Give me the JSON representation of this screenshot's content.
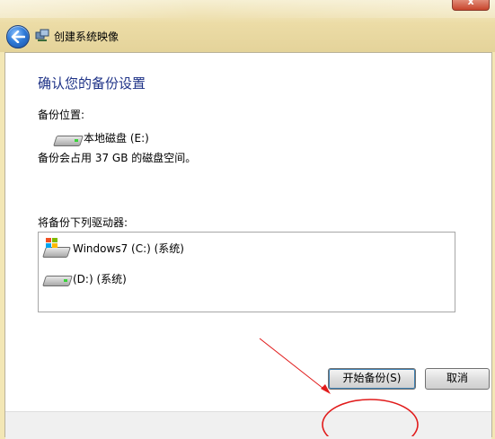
{
  "window": {
    "title": "创建系统映像",
    "close_glyph": "x"
  },
  "page": {
    "heading": "确认您的备份设置",
    "backup_location_label": "备份位置:",
    "backup_location_drive": "本地磁盘 (E:)",
    "space_note": "备份会占用 37 GB 的磁盘空间。",
    "included_drives_label": "将备份下列驱动器:",
    "included_drives": [
      {
        "label": "Windows7 (C:) (系统)",
        "icon": "windows-drive-icon"
      },
      {
        "label": "(D:) (系统)",
        "icon": "hard-drive-icon"
      }
    ]
  },
  "buttons": {
    "start_backup": "开始备份(S)",
    "cancel": "取消"
  },
  "colors": {
    "heading": "#1e3287",
    "annotation": "#e11b1b",
    "titlebar": "#ecdca6"
  }
}
